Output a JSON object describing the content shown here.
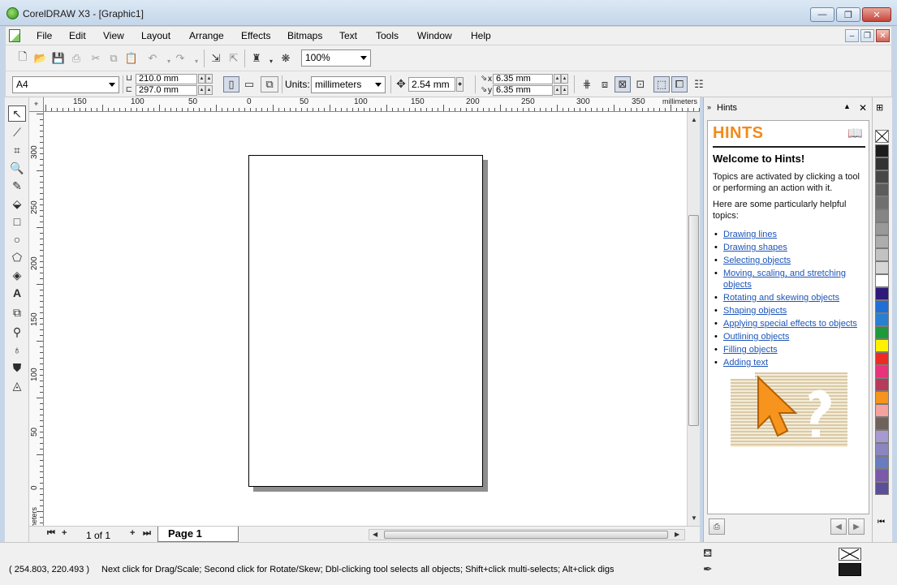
{
  "window": {
    "title": "CorelDRAW X3 - [Graphic1]",
    "minimize_glyph": "—",
    "restore_glyph": "❐",
    "close_glyph": "✕"
  },
  "menu": {
    "items": [
      "File",
      "Edit",
      "View",
      "Layout",
      "Arrange",
      "Effects",
      "Bitmaps",
      "Text",
      "Tools",
      "Window",
      "Help"
    ]
  },
  "standard_toolbar": {
    "zoom_value": "100%"
  },
  "property_bar": {
    "paper_size": "A4",
    "page_width": "210.0 mm",
    "page_height": "297.0 mm",
    "units_label": "Units:",
    "units_value": "millimeters",
    "nudge_distance": "2.54 mm",
    "duplicate_x": "6.35 mm",
    "duplicate_y": "6.35 mm",
    "dup_x_label": "x",
    "dup_y_label": "y"
  },
  "rulers": {
    "horizontal_labels": [
      "150",
      "100",
      "50",
      "0",
      "50",
      "100",
      "150",
      "200",
      "250",
      "300",
      "350"
    ],
    "horizontal_unit": "millimeters",
    "vertical_labels": [
      "300",
      "250",
      "200",
      "150",
      "100",
      "50",
      "0"
    ],
    "vertical_unit": "millimeters"
  },
  "page_nav": {
    "page_count": "1 of 1",
    "current_tab": "Page 1"
  },
  "hints": {
    "docker_title": "Hints",
    "heading": "HINTS",
    "welcome": "Welcome to Hints!",
    "intro": "Topics are activated by clicking a tool or performing an action with it.",
    "helpful": "Here are some particularly helpful topics:",
    "topics": [
      "Drawing lines",
      "Drawing shapes",
      "Selecting objects",
      "Moving, scaling, and stretching objects",
      "Rotating and skewing objects",
      "Shaping objects",
      "Applying special effects to objects",
      "Outlining objects",
      "Filling objects",
      "Adding text"
    ]
  },
  "palette": {
    "colors": [
      "#1c1c1c",
      "#333333",
      "#474747",
      "#5c5c5c",
      "#707070",
      "#858585",
      "#999999",
      "#adadad",
      "#c2c2c2",
      "#d6d6d6",
      "#ffffff",
      "#2e1a7a",
      "#1f6fd6",
      "#2a7fd0",
      "#1f9a3a",
      "#fff100",
      "#ee2a24",
      "#e8327a",
      "#b83a5a",
      "#f7941d",
      "#f5a2a0",
      "#6f625a",
      "#a69ad0",
      "#8c86c0",
      "#6a7cc0",
      "#7a5aa8",
      "#5c4f9a"
    ]
  },
  "status": {
    "coordinates": "( 254.803, 220.493 )",
    "message": "Next click for Drag/Scale; Second click for Rotate/Skew; Dbl-clicking tool selects all objects; Shift+click multi-selects; Alt+click digs"
  }
}
